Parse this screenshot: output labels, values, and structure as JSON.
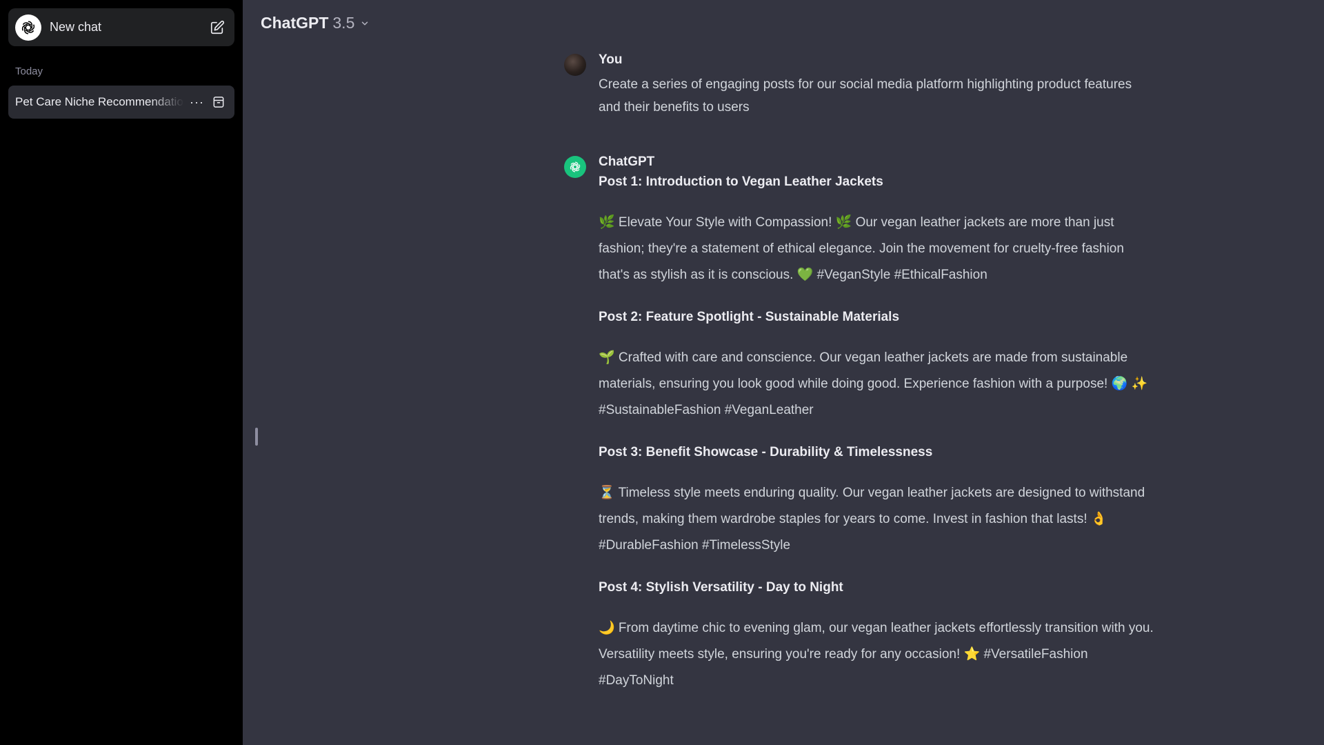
{
  "sidebar": {
    "new_chat_label": "New chat",
    "section_today": "Today",
    "history": [
      {
        "title": "Pet Care Niche Recommendations",
        "more_label": "···"
      }
    ]
  },
  "header": {
    "model_name": "ChatGPT",
    "model_version": "3.5"
  },
  "conversation": {
    "user": {
      "author": "You",
      "text": "Create a series of engaging posts for our social media platform highlighting product features and their benefits to users"
    },
    "assistant": {
      "author": "ChatGPT",
      "posts": [
        {
          "heading": "Post 1: Introduction to Vegan Leather Jackets",
          "text": "🌿 Elevate Your Style with Compassion! 🌿 Our vegan leather jackets are more than just fashion; they're a statement of ethical elegance. Join the movement for cruelty-free fashion that's as stylish as it is conscious. 💚 #VeganStyle #EthicalFashion"
        },
        {
          "heading": "Post 2: Feature Spotlight - Sustainable Materials",
          "text": "🌱 Crafted with care and conscience. Our vegan leather jackets are made from sustainable materials, ensuring you look good while doing good. Experience fashion with a purpose! 🌍 ✨ #SustainableFashion #VeganLeather"
        },
        {
          "heading": "Post 3: Benefit Showcase - Durability & Timelessness",
          "text": "⏳ Timeless style meets enduring quality. Our vegan leather jackets are designed to withstand trends, making them wardrobe staples for years to come. Invest in fashion that lasts! 👌 #DurableFashion #TimelessStyle"
        },
        {
          "heading": "Post 4: Stylish Versatility - Day to Night",
          "text": "🌙 From daytime chic to evening glam, our vegan leather jackets effortlessly transition with you. Versatility meets style, ensuring you're ready for any occasion! ⭐ #VersatileFashion #DayToNight"
        }
      ]
    }
  },
  "icons": {
    "logo": "openai-logo-icon",
    "edit": "edit-icon",
    "archive": "archive-icon",
    "chevron": "chevron-down-icon",
    "user_avatar": "user-avatar",
    "assistant_avatar": "chatgpt-avatar"
  },
  "colors": {
    "sidebar_bg": "#000000",
    "main_bg": "#343541",
    "assistant_accent": "#19c37d"
  }
}
